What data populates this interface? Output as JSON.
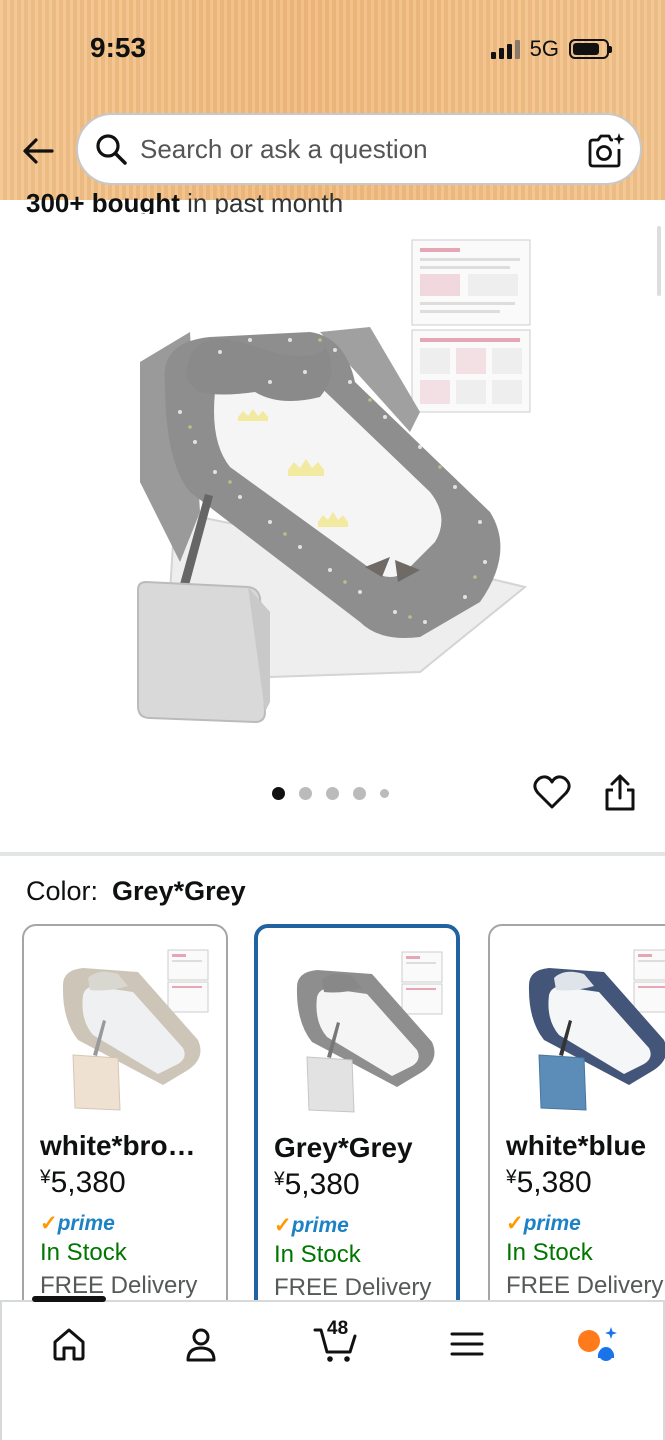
{
  "status_bar": {
    "time": "9:53",
    "network": "5G",
    "battery_level": 0.8
  },
  "search": {
    "placeholder": "Search or ask a question"
  },
  "product": {
    "bought_bold": "300+ bought",
    "bought_rest": " in past month",
    "image_pages": 5,
    "current_page": 1
  },
  "color": {
    "label": "Color:",
    "selected": "Grey*Grey"
  },
  "variants": [
    {
      "name": "white*bro…",
      "price_symbol": "¥",
      "price": "5,380",
      "prime": "prime",
      "stock": "In Stock",
      "delivery": "FREE Delivery",
      "selected": false
    },
    {
      "name": "Grey*Grey",
      "price_symbol": "¥",
      "price": "5,380",
      "prime": "prime",
      "stock": "In Stock",
      "delivery": "FREE Delivery",
      "selected": true
    },
    {
      "name": "white*blue",
      "price_symbol": "¥",
      "price": "5,380",
      "prime": "prime",
      "stock": "In Stock",
      "delivery": "FREE Delivery",
      "selected": false
    }
  ],
  "tabbar": {
    "items": [
      "home-icon",
      "account-icon",
      "cart-icon",
      "menu-icon",
      "assistant-icon"
    ],
    "cart_count": "48",
    "active": "home-icon"
  },
  "colors": {
    "prime_blue": "#1c82c5",
    "prime_check": "#ff9900",
    "in_stock": "#007600",
    "selected_border": "#2162a1",
    "header": "#f2b97c"
  }
}
